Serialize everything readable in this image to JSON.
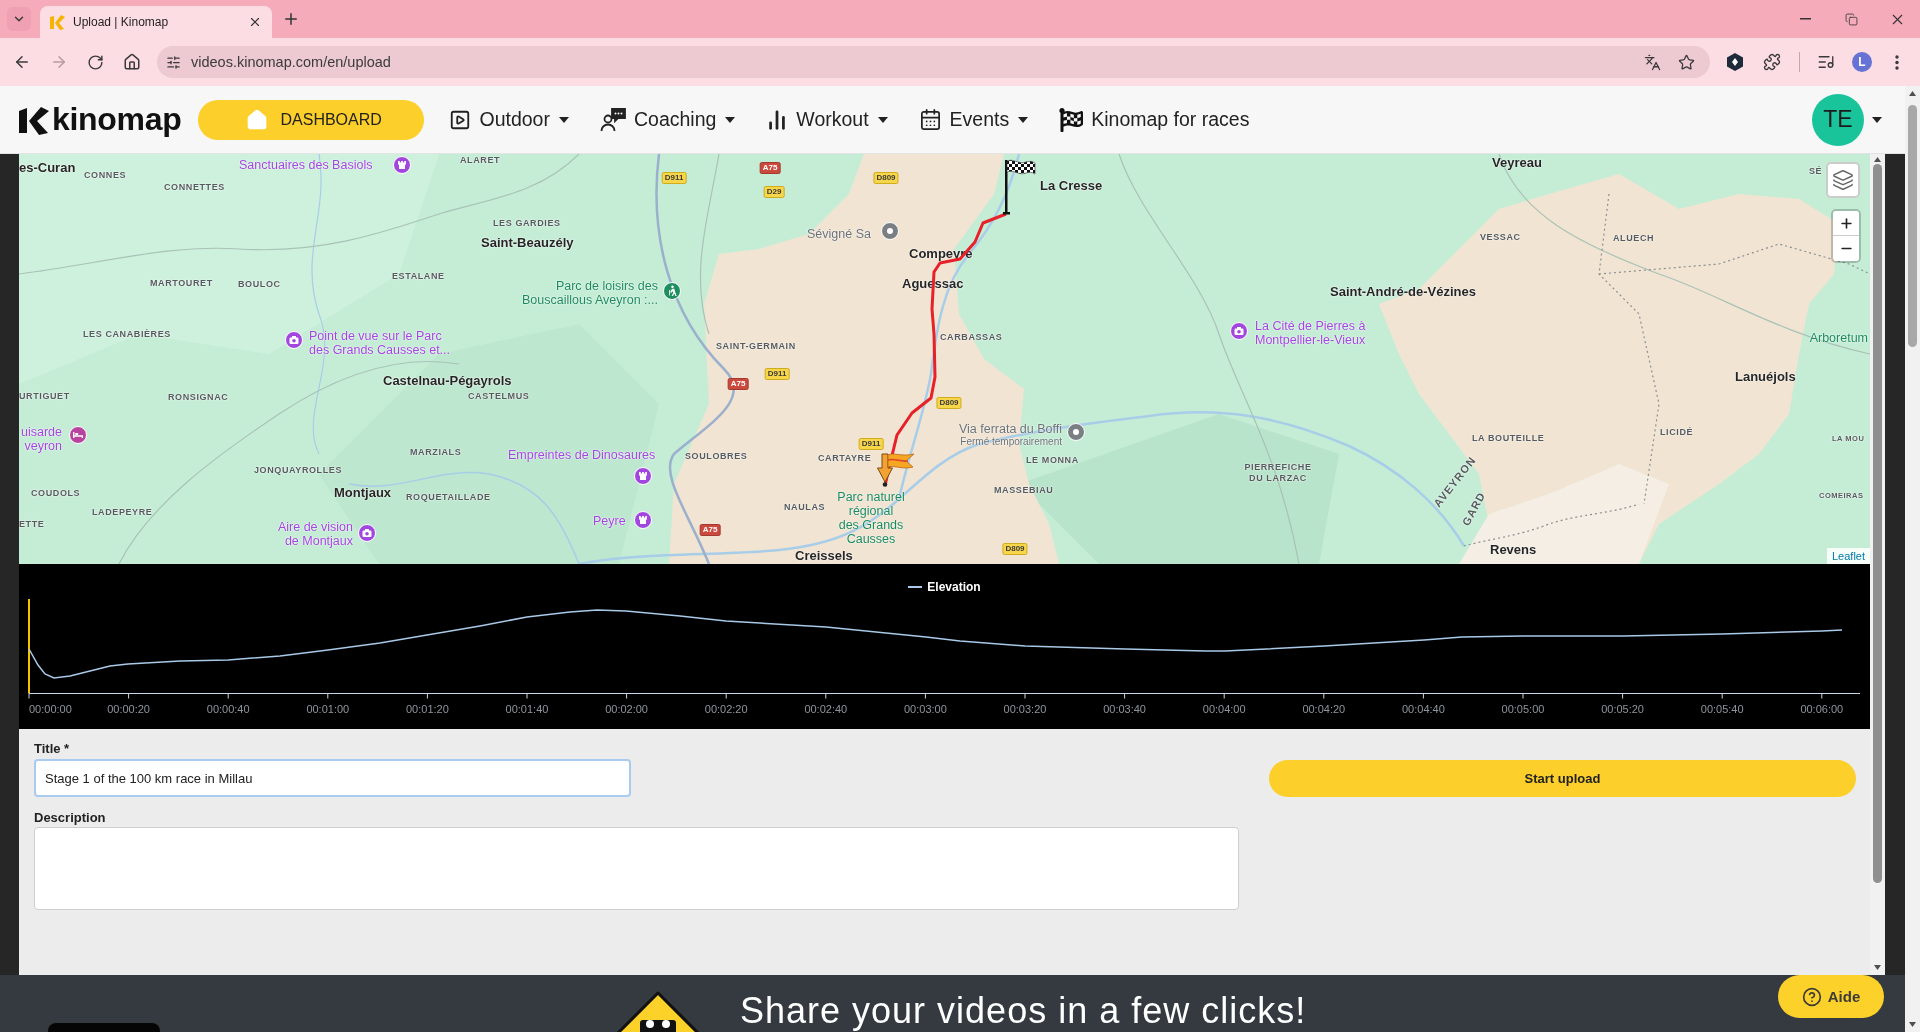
{
  "browser": {
    "tab_title": "Upload | Kinomap",
    "url": "videos.kinomap.com/en/upload",
    "forward_disabled": true,
    "profile_initial": "L"
  },
  "navbar": {
    "logo": "kinomap",
    "dashboard_button": "DASHBOARD",
    "menus": [
      {
        "label": "Outdoor",
        "dropdown": true
      },
      {
        "label": "Coaching",
        "dropdown": true
      },
      {
        "label": "Workout",
        "dropdown": true
      },
      {
        "label": "Events",
        "dropdown": true
      },
      {
        "label": "Kinomap for races",
        "dropdown": false
      }
    ],
    "avatar_initials": "TE"
  },
  "map": {
    "labels": [
      {
        "text": "es-Curan",
        "kind": "town"
      },
      {
        "text": "CONNES",
        "kind": "locality"
      },
      {
        "text": "CONNETTES",
        "kind": "locality"
      },
      {
        "text": "Sanctuaires des Basiols",
        "kind": "attraction"
      },
      {
        "text": "ALARET",
        "kind": "locality"
      },
      {
        "text": "D911",
        "kind": "road"
      },
      {
        "text": "A75",
        "kind": "motorway"
      },
      {
        "text": "D29",
        "kind": "road"
      },
      {
        "text": "D809",
        "kind": "road"
      },
      {
        "text": "La Cresse",
        "kind": "town"
      },
      {
        "text": "Veyreau",
        "kind": "town"
      },
      {
        "text": "SÉ",
        "kind": "locality"
      },
      {
        "text": "LES GARDIES",
        "kind": "locality"
      },
      {
        "text": "Saint-Beauzély",
        "kind": "town"
      },
      {
        "text": "Sévigné Sa",
        "kind": "place"
      },
      {
        "text": "Compeyre",
        "kind": "town"
      },
      {
        "text": "VESSAC",
        "kind": "locality"
      },
      {
        "text": "ALUECH",
        "kind": "locality"
      },
      {
        "text": "MARTOURET",
        "kind": "locality"
      },
      {
        "text": "BOULOC",
        "kind": "locality"
      },
      {
        "text": "ESTALANE",
        "kind": "locality"
      },
      {
        "text": "Parc de loisirs des\nBouscaillous Aveyron :...",
        "kind": "leisure"
      },
      {
        "text": "Aguessac",
        "kind": "town"
      },
      {
        "text": "Saint-André-de-Vézines",
        "kind": "town"
      },
      {
        "text": "LES CANABIÈRES",
        "kind": "locality"
      },
      {
        "text": "Point de vue sur le Parc\ndes Grands Causses et...",
        "kind": "attraction"
      },
      {
        "text": "SAINT-GERMAIN",
        "kind": "locality"
      },
      {
        "text": "CARBASSAS",
        "kind": "locality"
      },
      {
        "text": "La Cité de Pierres à\nMontpellier-le-Vieux",
        "kind": "attraction"
      },
      {
        "text": "Arboretum",
        "kind": "leisure"
      },
      {
        "text": "URTIGUET",
        "kind": "locality"
      },
      {
        "text": "RONSIGNAC",
        "kind": "locality"
      },
      {
        "text": "Castelnau-Pégayrols",
        "kind": "town"
      },
      {
        "text": "CASTELMUS",
        "kind": "locality"
      },
      {
        "text": "A75",
        "kind": "motorway"
      },
      {
        "text": "D911",
        "kind": "road"
      },
      {
        "text": "D809",
        "kind": "road"
      },
      {
        "text": "Lanuéjols",
        "kind": "town"
      },
      {
        "text": "uisarde\nveyron",
        "kind": "attraction"
      },
      {
        "text": "JONQUAYROLLES",
        "kind": "locality"
      },
      {
        "text": "MARZIALS",
        "kind": "locality"
      },
      {
        "text": "Empreintes de Dinosaures",
        "kind": "attraction"
      },
      {
        "text": "SOULOBRES",
        "kind": "locality"
      },
      {
        "text": "CARTAYRE",
        "kind": "locality"
      },
      {
        "text": "D911",
        "kind": "road"
      },
      {
        "text": "Via ferrata du Boffi",
        "kind": "place",
        "note": "Fermé temporairement"
      },
      {
        "text": "LE MONNA",
        "kind": "locality"
      },
      {
        "text": "PIERREFICHE\nDU LARZAC",
        "kind": "locality"
      },
      {
        "text": "LA BOUTEILLE",
        "kind": "locality"
      },
      {
        "text": "LICIDÉ",
        "kind": "locality"
      },
      {
        "text": "LA MOU",
        "kind": "hamlet"
      },
      {
        "text": "COUDOLS",
        "kind": "locality"
      },
      {
        "text": "Montjaux",
        "kind": "town"
      },
      {
        "text": "ROQUETAILLADE",
        "kind": "locality"
      },
      {
        "text": "LADEPEYRE",
        "kind": "locality"
      },
      {
        "text": "ETTE",
        "kind": "locality"
      },
      {
        "text": "Aire de vision\nde Montjaux",
        "kind": "attraction"
      },
      {
        "text": "Peyre",
        "kind": "attraction"
      },
      {
        "text": "A75",
        "kind": "motorway"
      },
      {
        "text": "NAULAS",
        "kind": "locality"
      },
      {
        "text": "Parc naturel\nrégional\ndes Grands\nCausses",
        "kind": "leisure"
      },
      {
        "text": "Creissels",
        "kind": "town"
      },
      {
        "text": "MASSEBIAU",
        "kind": "locality"
      },
      {
        "text": "D809",
        "kind": "road"
      },
      {
        "text": "AVEYRON",
        "kind": "border"
      },
      {
        "text": "GARD",
        "kind": "border"
      },
      {
        "text": "Revens",
        "kind": "town"
      },
      {
        "text": "COMEIRAS",
        "kind": "hamlet"
      }
    ],
    "attribution": "Leaflet"
  },
  "elevation_chart": {
    "legend": "Elevation",
    "time_labels": [
      "00:00:00",
      "00:00:20",
      "00:00:40",
      "00:01:00",
      "00:01:20",
      "00:01:40",
      "00:02:00",
      "00:02:20",
      "00:02:40",
      "00:03:00",
      "00:03:20",
      "00:03:40",
      "00:04:00",
      "00:04:20",
      "00:04:40",
      "00:05:00",
      "00:05:20",
      "00:05:40",
      "00:06:00"
    ]
  },
  "upload_form": {
    "title_label": "Title *",
    "title_value": "Stage 1 of the 100 km race in Millau",
    "title_focused": true,
    "description_label": "Description",
    "submit_button": "Start upload"
  },
  "footer": {
    "headline": "Share your videos in a few clicks!",
    "help_button": "Aide"
  }
}
